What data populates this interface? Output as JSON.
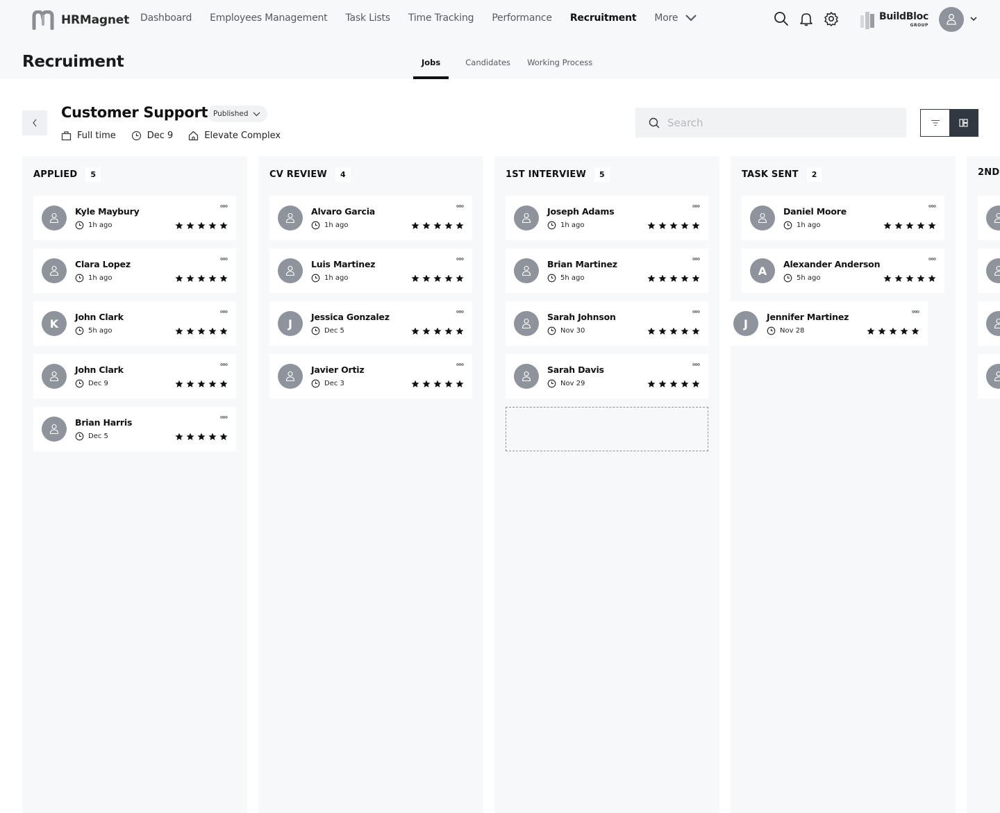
{
  "app": {
    "name": "HRMagnet",
    "brand": {
      "name": "BuildBloc",
      "sub": "GROUP"
    }
  },
  "nav": {
    "items": [
      {
        "label": "Dashboard",
        "active": false
      },
      {
        "label": "Employees Management",
        "active": false
      },
      {
        "label": "Task Lists",
        "active": false
      },
      {
        "label": "Time Tracking",
        "active": false
      },
      {
        "label": "Performance",
        "active": false
      },
      {
        "label": "Recruitment",
        "active": true
      }
    ],
    "more_label": "More",
    "icons": [
      "search-icon",
      "bell-icon",
      "gear-icon"
    ]
  },
  "page": {
    "title": "Recruiment",
    "tabs": [
      {
        "label": "Jobs",
        "active": true
      },
      {
        "label": "Candidates",
        "active": false
      },
      {
        "label": "Working Process",
        "active": false
      }
    ]
  },
  "job": {
    "title": "Customer Support",
    "status": "Published",
    "type": "Full time",
    "date": "Dec 9",
    "location": "Elevate Complex"
  },
  "search": {
    "placeholder": "Search",
    "value": ""
  },
  "view_toggle": {
    "active": "board"
  },
  "columns": [
    {
      "title": "APPLIED",
      "count": "5",
      "cards": [
        {
          "name": "Kyle Maybury",
          "time": "1h ago",
          "initial": "",
          "rating": 5
        },
        {
          "name": "Clara Lopez",
          "time": "1h ago",
          "initial": "",
          "rating": 5
        },
        {
          "name": "John Clark",
          "time": "5h ago",
          "initial": "K",
          "rating": 5
        },
        {
          "name": "John Clark",
          "time": "Dec 9",
          "initial": "",
          "rating": 5
        },
        {
          "name": "Brian Harris",
          "time": "Dec 5",
          "initial": "",
          "rating": 5
        }
      ]
    },
    {
      "title": "CV REVIEW",
      "count": "4",
      "cards": [
        {
          "name": "Alvaro Garcia",
          "time": "1h ago",
          "initial": "",
          "rating": 5
        },
        {
          "name": "Luis Martinez",
          "time": "1h ago",
          "initial": "",
          "rating": 5
        },
        {
          "name": "Jessica Gonzalez",
          "time": "Dec 5",
          "initial": "J",
          "rating": 5
        },
        {
          "name": "Javier Ortiz",
          "time": "Dec 3",
          "initial": "",
          "rating": 5
        }
      ]
    },
    {
      "title": "1ST INTERVIEW",
      "count": "5",
      "cards": [
        {
          "name": "Joseph Adams",
          "time": "1h ago",
          "initial": "",
          "rating": 5
        },
        {
          "name": "Brian Martinez",
          "time": "5h ago",
          "initial": "",
          "rating": 5
        },
        {
          "name": "Sarah Johnson",
          "time": "Nov 30",
          "initial": "",
          "rating": 5
        },
        {
          "name": "Sarah Davis",
          "time": "Nov 29",
          "initial": "",
          "rating": 5
        }
      ],
      "drop_placeholder": true
    },
    {
      "title": "TASK SENT",
      "count": "2",
      "cards": [
        {
          "name": "Daniel Moore",
          "time": "1h ago",
          "initial": "",
          "rating": 5
        },
        {
          "name": "Alexander Anderson",
          "time": "5h ago",
          "initial": "A",
          "rating": 5
        }
      ]
    },
    {
      "title": "2ND",
      "count": "",
      "cards": [
        {
          "name": "",
          "time": "",
          "initial": "",
          "rating": 0
        },
        {
          "name": "",
          "time": "",
          "initial": "",
          "rating": 0
        },
        {
          "name": "",
          "time": "",
          "initial": "",
          "rating": 0
        },
        {
          "name": "",
          "time": "",
          "initial": "",
          "rating": 0
        }
      ]
    }
  ],
  "dragging_card": {
    "name": "Jennifer Martinez",
    "time": "Nov 28",
    "initial": "J",
    "rating": 5
  }
}
